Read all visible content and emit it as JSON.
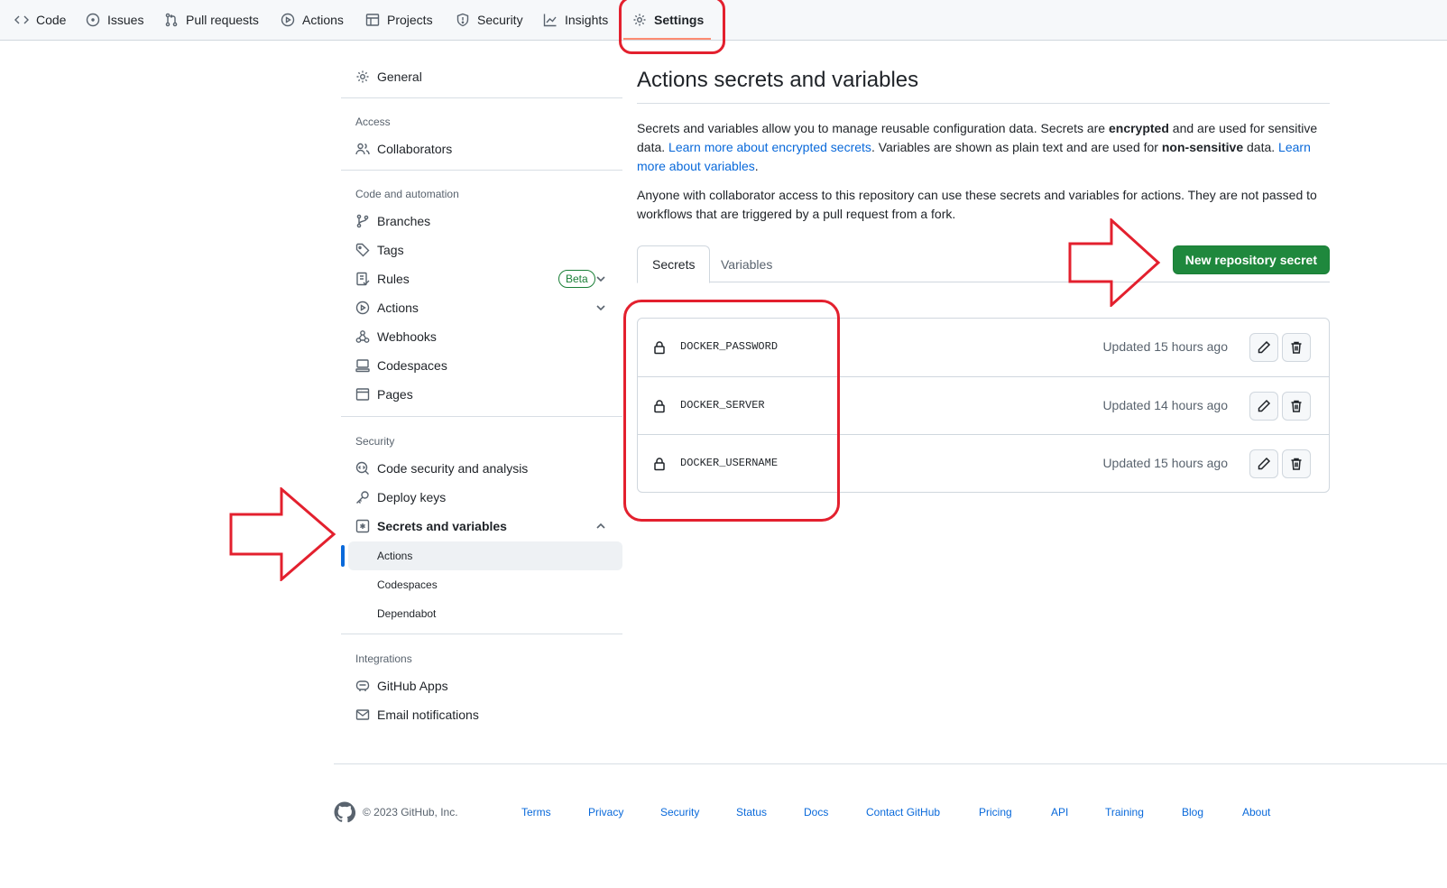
{
  "topnav": {
    "tabs": [
      {
        "label": "Code",
        "icon": "code-icon"
      },
      {
        "label": "Issues",
        "icon": "issue-icon"
      },
      {
        "label": "Pull requests",
        "icon": "pull-request-icon"
      },
      {
        "label": "Actions",
        "icon": "play-icon"
      },
      {
        "label": "Projects",
        "icon": "table-icon"
      },
      {
        "label": "Security",
        "icon": "shield-icon"
      },
      {
        "label": "Insights",
        "icon": "graph-icon"
      },
      {
        "label": "Settings",
        "icon": "gear-icon",
        "active": true
      }
    ]
  },
  "sidebar": {
    "general": "General",
    "access_heading": "Access",
    "collaborators": "Collaborators",
    "code_heading": "Code and automation",
    "branches": "Branches",
    "tags": "Tags",
    "rules": "Rules",
    "rules_badge": "Beta",
    "actions": "Actions",
    "webhooks": "Webhooks",
    "codespaces": "Codespaces",
    "pages": "Pages",
    "security_heading": "Security",
    "code_security": "Code security and analysis",
    "deploy_keys": "Deploy keys",
    "secrets_vars": "Secrets and variables",
    "sub_actions": "Actions",
    "sub_codespaces": "Codespaces",
    "sub_dependabot": "Dependabot",
    "integrations_heading": "Integrations",
    "github_apps": "GitHub Apps",
    "email_notifications": "Email notifications"
  },
  "main": {
    "title": "Actions secrets and variables",
    "p1_a": "Secrets and variables allow you to manage reusable configuration data. Secrets are ",
    "p1_b": "encrypted",
    "p1_c": " and are used for sensitive data. ",
    "p1_link1": "Learn more about encrypted secrets",
    "p1_d": ". Variables are shown as plain text and are used for ",
    "p1_e": "non-sensitive",
    "p1_f": " data. ",
    "p1_link2": "Learn more about variables",
    "p1_g": ".",
    "p2": "Anyone with collaborator access to this repository can use these secrets and variables for actions. They are not passed to workflows that are triggered by a pull request from a fork.",
    "tab_secrets": "Secrets",
    "tab_variables": "Variables",
    "new_secret_button": "New repository secret",
    "secrets": [
      {
        "name": "DOCKER_PASSWORD",
        "updated": "Updated 15 hours ago"
      },
      {
        "name": "DOCKER_SERVER",
        "updated": "Updated 14 hours ago"
      },
      {
        "name": "DOCKER_USERNAME",
        "updated": "Updated 15 hours ago"
      }
    ]
  },
  "footer": {
    "copyright": "© 2023 GitHub, Inc.",
    "links": [
      "Terms",
      "Privacy",
      "Security",
      "Status",
      "Docs",
      "Contact GitHub",
      "Pricing",
      "API",
      "Training",
      "Blog",
      "About"
    ]
  },
  "colors": {
    "accent_blue": "#0969da",
    "primary_green": "#1f883d",
    "annotation_red": "#e3202e",
    "active_tab_underline": "#fd8c73"
  }
}
